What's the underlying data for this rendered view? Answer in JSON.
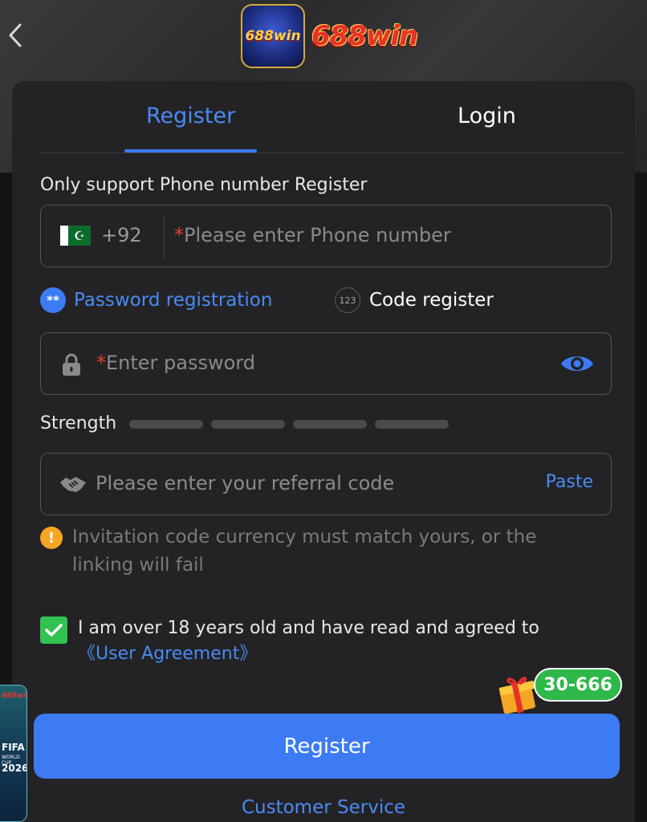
{
  "brand": {
    "logo_text": "688win",
    "badge_text": "688win"
  },
  "tabs": {
    "register": "Register",
    "login": "Login"
  },
  "form": {
    "note": "Only support Phone number Register",
    "country_code": "+92",
    "required_mark": "*",
    "phone_placeholder": "Please enter Phone number",
    "mode_password": "Password registration",
    "mode_password_icon": "**",
    "mode_code": "Code register",
    "mode_code_icon": "123",
    "password_placeholder": "Enter password",
    "strength_label": "Strength",
    "referral_placeholder": "Please enter your referral code",
    "paste": "Paste",
    "warning_icon": "!",
    "warning": "Invitation code currency must match yours, or the linking will fail",
    "agree_text": "I am over 18 years old and have read and agreed to",
    "agree_link": "《User Agreement》"
  },
  "register_button": "Register",
  "customer_service": "Customer Service",
  "promo_badge": "30-666",
  "side_banner": {
    "brand": "688win",
    "line1": "FIFA",
    "line2": "WORLD CUP",
    "line3": "2026"
  },
  "colors": {
    "accent": "#3d7bf4",
    "check": "#31c251",
    "warning": "#f5a623",
    "required": "#e0442d"
  }
}
